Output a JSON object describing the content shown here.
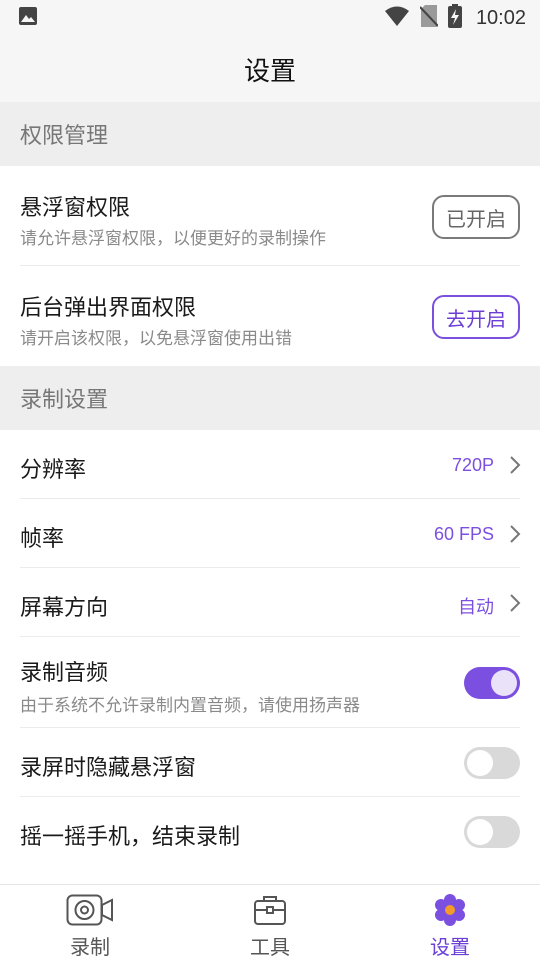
{
  "status_bar": {
    "time": "10:02"
  },
  "header": {
    "title": "设置"
  },
  "sections": {
    "permissions": {
      "title": "权限管理",
      "items": [
        {
          "title": "悬浮窗权限",
          "subtitle": "请允许悬浮窗权限，以便更好的录制操作",
          "button": "已开启"
        },
        {
          "title": "后台弹出界面权限",
          "subtitle": "请开启该权限，以免悬浮窗使用出错",
          "button": "去开启"
        }
      ]
    },
    "recording": {
      "title": "录制设置",
      "items": [
        {
          "title": "分辨率",
          "value": "720P"
        },
        {
          "title": "帧率",
          "value": "60 FPS"
        },
        {
          "title": "屏幕方向",
          "value": "自动"
        },
        {
          "title": "录制音频",
          "subtitle": "由于系统不允许录制内置音频，请使用扬声器",
          "toggle": true
        },
        {
          "title": "录屏时隐藏悬浮窗",
          "toggle": false
        },
        {
          "title": "摇一摇手机，结束录制",
          "toggle": false
        }
      ]
    }
  },
  "bottom_nav": {
    "items": [
      {
        "label": "录制",
        "icon": "camera-icon"
      },
      {
        "label": "工具",
        "icon": "toolbox-icon"
      },
      {
        "label": "设置",
        "icon": "settings-flower-icon"
      }
    ],
    "active_index": 2
  },
  "colors": {
    "accent": "#7b4fe0",
    "toggle_off": "#d9d9d9",
    "nav_active_orange": "#f39a2b"
  }
}
